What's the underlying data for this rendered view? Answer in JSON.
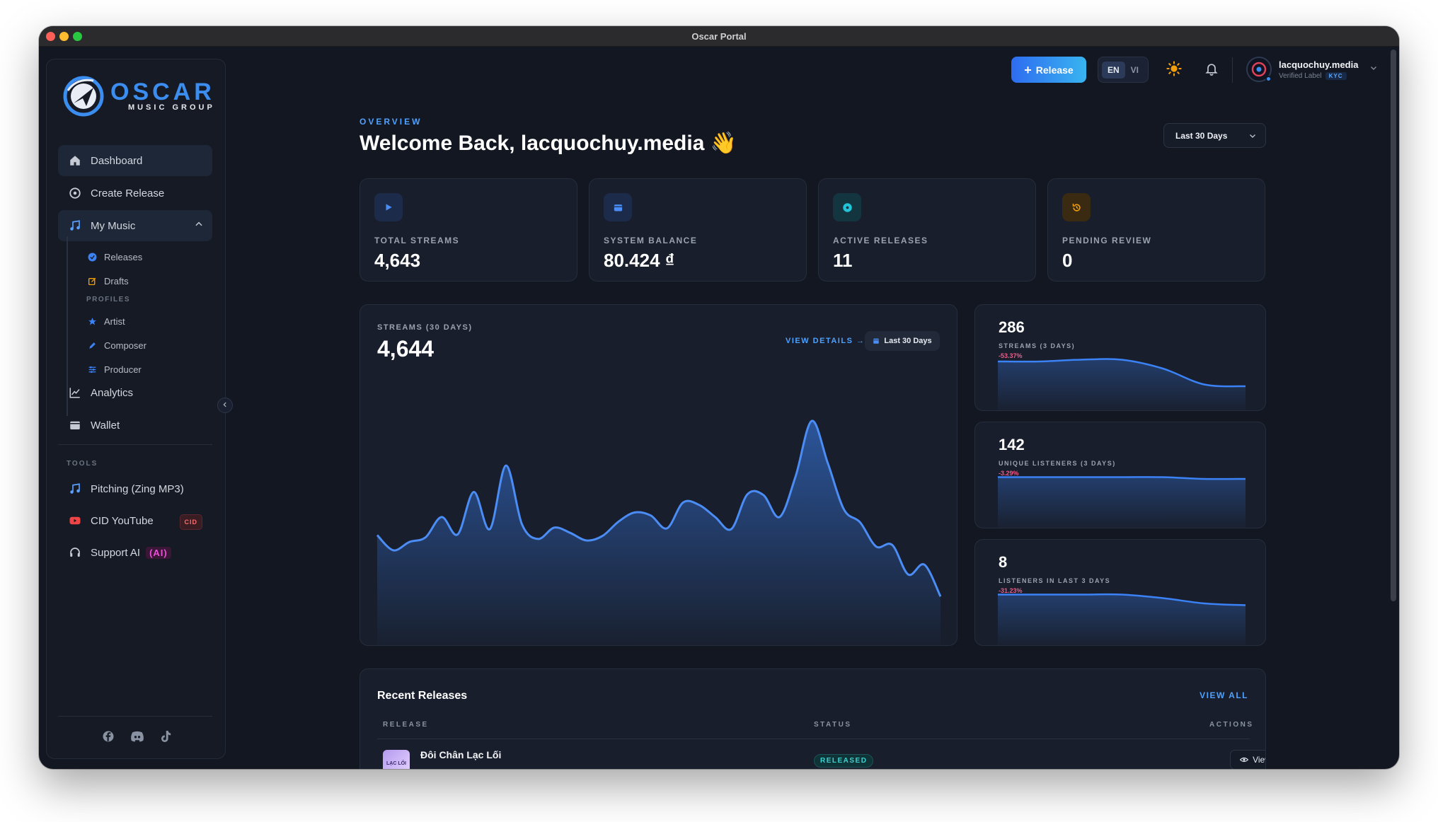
{
  "window": {
    "title": "Oscar Portal"
  },
  "logo": {
    "main": "OSCAR",
    "sub": "MUSIC GROUP"
  },
  "sidebar": {
    "items": [
      {
        "label": "Dashboard",
        "icon": "home-icon"
      },
      {
        "label": "Create Release",
        "icon": "disc-icon"
      },
      {
        "label": "My Music",
        "icon": "music-note-icon"
      },
      {
        "label": "Analytics",
        "icon": "chart-line-icon"
      },
      {
        "label": "Wallet",
        "icon": "wallet-icon"
      }
    ],
    "sub_items": [
      {
        "label": "Releases",
        "icon": "check-circle-icon"
      },
      {
        "label": "Drafts",
        "icon": "edit-icon"
      }
    ],
    "profiles_label": "PROFILES",
    "profile_items": [
      {
        "label": "Artist",
        "icon": "star-icon"
      },
      {
        "label": "Composer",
        "icon": "pen-icon"
      },
      {
        "label": "Producer",
        "icon": "sliders-icon"
      }
    ],
    "tools_label": "TOOLS",
    "tools": [
      {
        "label": "Pitching (Zing MP3)",
        "icon": "music-note-icon"
      },
      {
        "label": "CID YouTube",
        "icon": "youtube-icon",
        "badge": "CID"
      },
      {
        "label": "Support AI",
        "icon": "headset-icon",
        "badge": "(AI)"
      }
    ],
    "socials": [
      "facebook-icon",
      "discord-icon",
      "tiktok-icon"
    ]
  },
  "topbar": {
    "release_button": "Release",
    "languages": [
      "EN",
      "VI"
    ],
    "active_language": "EN",
    "user": {
      "name": "lacquochuy.media",
      "role": "Verified Label",
      "badge": "KYC"
    }
  },
  "header": {
    "overview": "OVERVIEW",
    "welcome": "Welcome Back, lacquochuy.media 👋",
    "range": "Last 30 Days"
  },
  "stats": [
    {
      "label": "TOTAL STREAMS",
      "value": "4,643",
      "icon": "play-icon",
      "color": "#3b82f6"
    },
    {
      "label": "SYSTEM BALANCE",
      "value": "80.424 ₫",
      "icon": "wallet-icon",
      "color": "#3b82f6"
    },
    {
      "label": "ACTIVE RELEASES",
      "value": "11",
      "icon": "disc-icon",
      "color": "#22c4d8"
    },
    {
      "label": "PENDING REVIEW",
      "value": "0",
      "icon": "history-icon",
      "color": "#f59e0b"
    }
  ],
  "streams_chart": {
    "label": "STREAMS (30 DAYS)",
    "value": "4,644",
    "view_details": "VIEW DETAILS →",
    "range": "Last 30 Days"
  },
  "chart_data": {
    "type": "area",
    "x": [
      0,
      1,
      2,
      3,
      4,
      5,
      6,
      7,
      8,
      9,
      10,
      11,
      12,
      13,
      14,
      15,
      16,
      17,
      18,
      19,
      20,
      21,
      22,
      23,
      24,
      25,
      26,
      27,
      28,
      29,
      30,
      31,
      32,
      33,
      34,
      35
    ],
    "values": [
      121,
      101,
      112,
      118,
      145,
      122,
      178,
      129,
      213,
      135,
      116,
      131,
      124,
      114,
      120,
      139,
      151,
      147,
      130,
      164,
      161,
      145,
      129,
      175,
      174,
      145,
      199,
      272,
      216,
      155,
      138,
      106,
      108,
      69,
      82,
      40
    ]
  },
  "mini_cards": [
    {
      "value": "286",
      "label": "STREAMS (3 DAYS)",
      "change": "-53.37%",
      "values": [
        30,
        30,
        31,
        31,
        26,
        17,
        16
      ]
    },
    {
      "value": "142",
      "label": "UNIQUE LISTENERS (3 DAYS)",
      "change": "-3.29%",
      "values": [
        31,
        31,
        31,
        31,
        31,
        30,
        30
      ]
    },
    {
      "value": "8",
      "label": "LISTENERS IN LAST 3 DAYS",
      "change": "-31.23%",
      "values": [
        31,
        31,
        31,
        31,
        29,
        26,
        25
      ]
    }
  ],
  "recent": {
    "title": "Recent Releases",
    "view_all": "VIEW ALL",
    "columns": [
      "RELEASE",
      "STATUS",
      "ACTIONS"
    ],
    "rows": [
      {
        "name": "Đôi Chân Lạc Lối",
        "cover_text": "LẠC LỐI",
        "status": "RELEASED",
        "action": "View"
      }
    ]
  }
}
